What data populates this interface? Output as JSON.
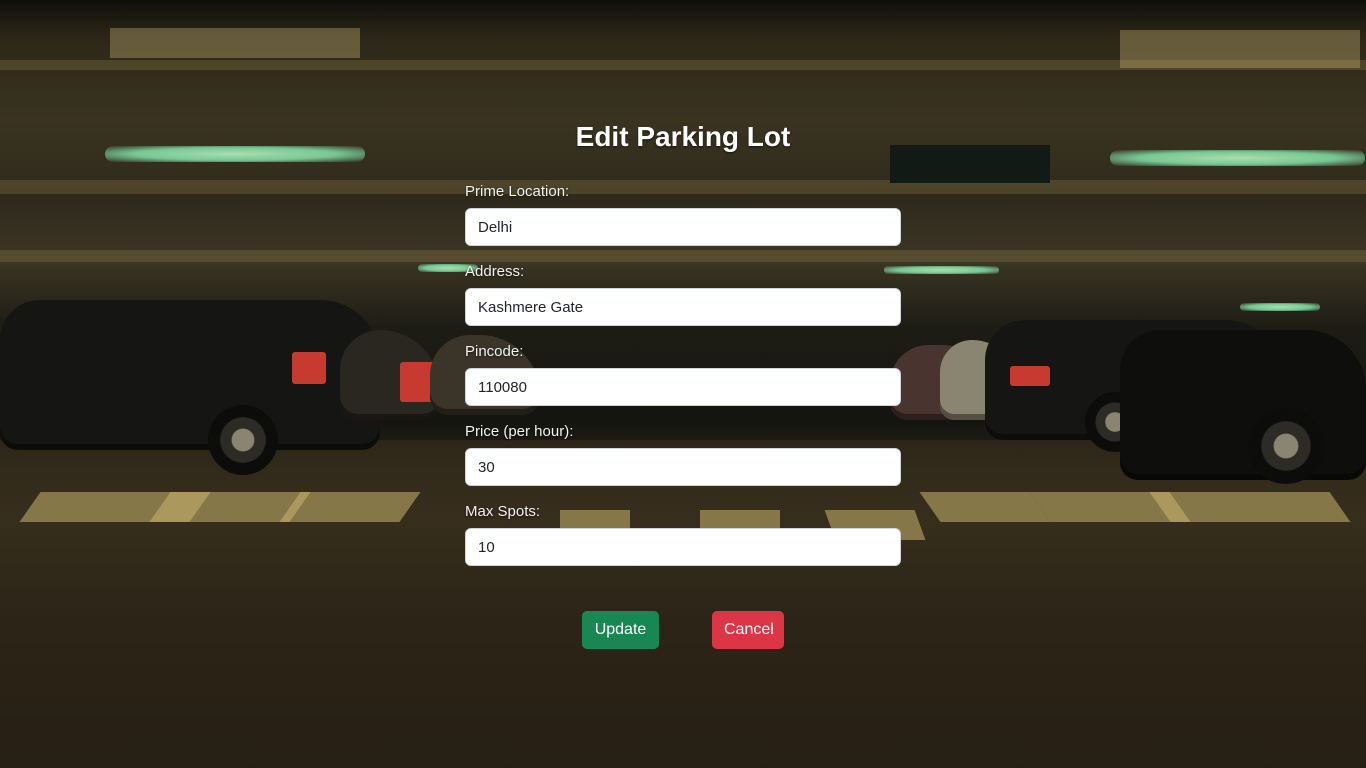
{
  "page": {
    "title": "Edit Parking Lot"
  },
  "form": {
    "fields": [
      {
        "label": "Prime Location:",
        "value": "Delhi"
      },
      {
        "label": "Address:",
        "value": "Kashmere Gate"
      },
      {
        "label": "Pincode:",
        "value": "110080"
      },
      {
        "label": "Price (per hour):",
        "value": "30"
      },
      {
        "label": "Max Spots:",
        "value": "10"
      }
    ],
    "update_label": "Update",
    "cancel_label": "Cancel"
  },
  "colors": {
    "update_button": "#198754",
    "cancel_button": "#dc3545"
  }
}
